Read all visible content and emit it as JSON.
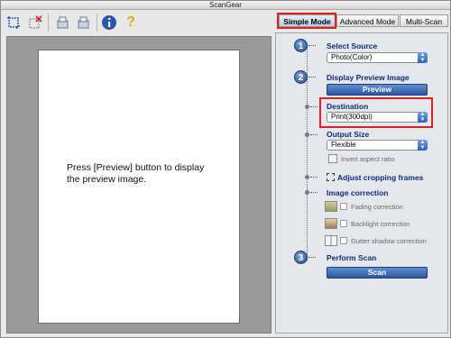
{
  "window": {
    "title": "ScanGear"
  },
  "toolbar": {
    "items": [
      {
        "icon": "crop-icon"
      },
      {
        "icon": "remove-crop-icon"
      },
      {
        "icon": "rotate-left-icon"
      },
      {
        "icon": "rotate-right-icon"
      },
      {
        "icon": "info-icon"
      },
      {
        "icon": "help-icon"
      }
    ]
  },
  "tabs": [
    {
      "label": "Simple Mode",
      "active": true
    },
    {
      "label": "Advanced Mode",
      "active": false
    },
    {
      "label": "Multi-Scan",
      "active": false
    }
  ],
  "preview": {
    "message_line1": "Press [Preview] button to display",
    "message_line2": "the preview image."
  },
  "panel": {
    "step1": {
      "number": "1",
      "label": "Select Source",
      "value": "Photo(Color)"
    },
    "step2": {
      "number": "2",
      "label": "Display Preview Image",
      "button": "Preview"
    },
    "destination": {
      "label": "Destination",
      "value": "Print(300dpi)"
    },
    "output_size": {
      "label": "Output Size",
      "value": "Flexible",
      "invert_label": "Invert aspect ratio"
    },
    "crop": {
      "label": "Adjust cropping frames"
    },
    "image_correction": {
      "label": "Image correction",
      "fading": "Fading correction",
      "backlight": "Backlight correction",
      "gutter": "Gutter shadow correction"
    },
    "step3": {
      "number": "3",
      "label": "Perform Scan",
      "button": "Scan"
    }
  },
  "colors": {
    "highlight": "#e01f1f",
    "accent": "#2b56a0",
    "section_label": "#0d2d7a"
  }
}
